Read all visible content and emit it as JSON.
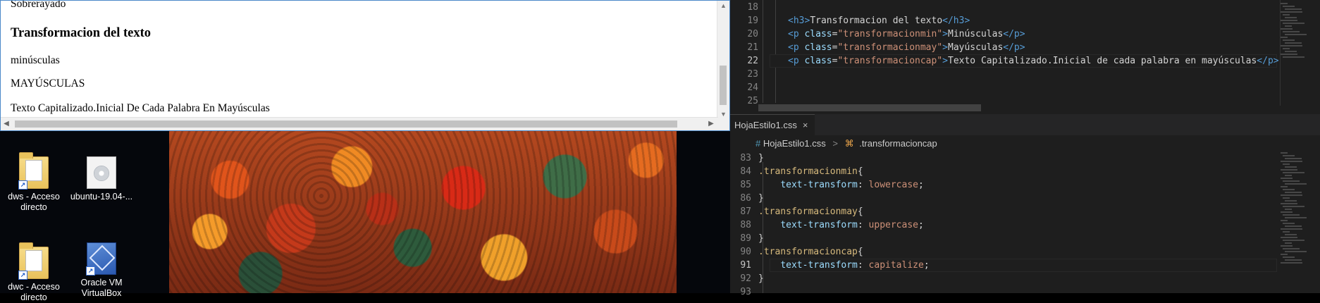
{
  "browser": {
    "cut_text": "Sobrerayado",
    "heading": "Transformacion del texto",
    "lines": [
      "minúsculas",
      "MAYÚSCULAS",
      "Texto Capitalizado.Inicial De Cada Palabra En Mayúsculas"
    ],
    "scroll_up_glyph": "▲",
    "scroll_down_glyph": "▼",
    "scroll_left_glyph": "◀",
    "scroll_right_glyph": "▶"
  },
  "desktop": {
    "icons": [
      {
        "label": "dws - Acceso directo",
        "icon": "folder-icon"
      },
      {
        "label": "ubuntu-19.04-...",
        "icon": "disc-image-icon"
      },
      {
        "label": "dwc - Acceso directo",
        "icon": "folder-icon"
      },
      {
        "label": "Oracle VM VirtualBox",
        "icon": "virtualbox-icon"
      }
    ],
    "shortcut_glyph": "↗"
  },
  "editor_html": {
    "lines": [
      {
        "num": "18",
        "parts": []
      },
      {
        "num": "19",
        "parts": [
          [
            "tag",
            "<h3>"
          ],
          [
            "txt",
            "Transformacion del texto"
          ],
          [
            "tag",
            "</h3>"
          ]
        ]
      },
      {
        "num": "20",
        "parts": [
          [
            "tag",
            "<p "
          ],
          [
            "attr",
            "class"
          ],
          [
            "txt",
            "="
          ],
          [
            "str",
            "\"transformacionmin\""
          ],
          [
            "tag",
            ">"
          ],
          [
            "txt",
            "Minúsculas"
          ],
          [
            "tag",
            "</p>"
          ]
        ]
      },
      {
        "num": "21",
        "parts": [
          [
            "tag",
            "<p "
          ],
          [
            "attr",
            "class"
          ],
          [
            "txt",
            "="
          ],
          [
            "str",
            "\"transformacionmay\""
          ],
          [
            "tag",
            ">"
          ],
          [
            "txt",
            "Mayúsculas"
          ],
          [
            "tag",
            "</p>"
          ]
        ]
      },
      {
        "num": "22",
        "parts": [
          [
            "tag",
            "<p "
          ],
          [
            "attr",
            "class"
          ],
          [
            "txt",
            "="
          ],
          [
            "str",
            "\"transformacioncap\""
          ],
          [
            "tag",
            ">"
          ],
          [
            "txt",
            "Texto Capitalizado.Inicial de cada palabra en mayúsculas"
          ],
          [
            "tag",
            "</p>"
          ]
        ]
      },
      {
        "num": "23",
        "parts": []
      },
      {
        "num": "24",
        "parts": []
      },
      {
        "num": "25",
        "parts": []
      }
    ],
    "active_line": "22"
  },
  "editor_css": {
    "tab_label": "HojaEstilo1.css",
    "tab_close": "×",
    "breadcrumb_hash": "#",
    "breadcrumb_file": "HojaEstilo1.css",
    "breadcrumb_sep": ">",
    "breadcrumb_symbol_glyph": "⌘",
    "breadcrumb_symbol": ".transformacioncap",
    "lines": [
      {
        "num": "83",
        "parts": [
          [
            "txt",
            "}"
          ]
        ]
      },
      {
        "num": "84",
        "parts": [
          [
            "sel",
            ".transformacionmin"
          ],
          [
            "txt",
            "{"
          ]
        ]
      },
      {
        "num": "85",
        "parts": [
          [
            "txt",
            "    "
          ],
          [
            "prop",
            "text-transform"
          ],
          [
            "txt",
            ": "
          ],
          [
            "val",
            "lowercase"
          ],
          [
            "txt",
            ";"
          ]
        ]
      },
      {
        "num": "86",
        "parts": [
          [
            "txt",
            "}"
          ]
        ]
      },
      {
        "num": "87",
        "parts": [
          [
            "sel",
            ".transformacionmay"
          ],
          [
            "txt",
            "{"
          ]
        ]
      },
      {
        "num": "88",
        "parts": [
          [
            "txt",
            "    "
          ],
          [
            "prop",
            "text-transform"
          ],
          [
            "txt",
            ": "
          ],
          [
            "val",
            "uppercase"
          ],
          [
            "txt",
            ";"
          ]
        ]
      },
      {
        "num": "89",
        "parts": [
          [
            "txt",
            "}"
          ]
        ]
      },
      {
        "num": "90",
        "parts": [
          [
            "sel",
            ".transformacioncap"
          ],
          [
            "txt",
            "{"
          ]
        ]
      },
      {
        "num": "91",
        "parts": [
          [
            "txt",
            "    "
          ],
          [
            "prop",
            "text-transform"
          ],
          [
            "txt",
            ": "
          ],
          [
            "val",
            "capitalize"
          ],
          [
            "txt",
            ";"
          ]
        ]
      },
      {
        "num": "92",
        "parts": [
          [
            "txt",
            "}"
          ]
        ]
      },
      {
        "num": "93",
        "parts": []
      }
    ],
    "active_line": "91"
  },
  "colors": {
    "editor_bg": "#1e1e1e",
    "tag": "#569cd6",
    "attribute": "#9cdcfe",
    "string": "#ce9178",
    "selector": "#d7ba7d",
    "browser_border": "#4a88c8"
  }
}
